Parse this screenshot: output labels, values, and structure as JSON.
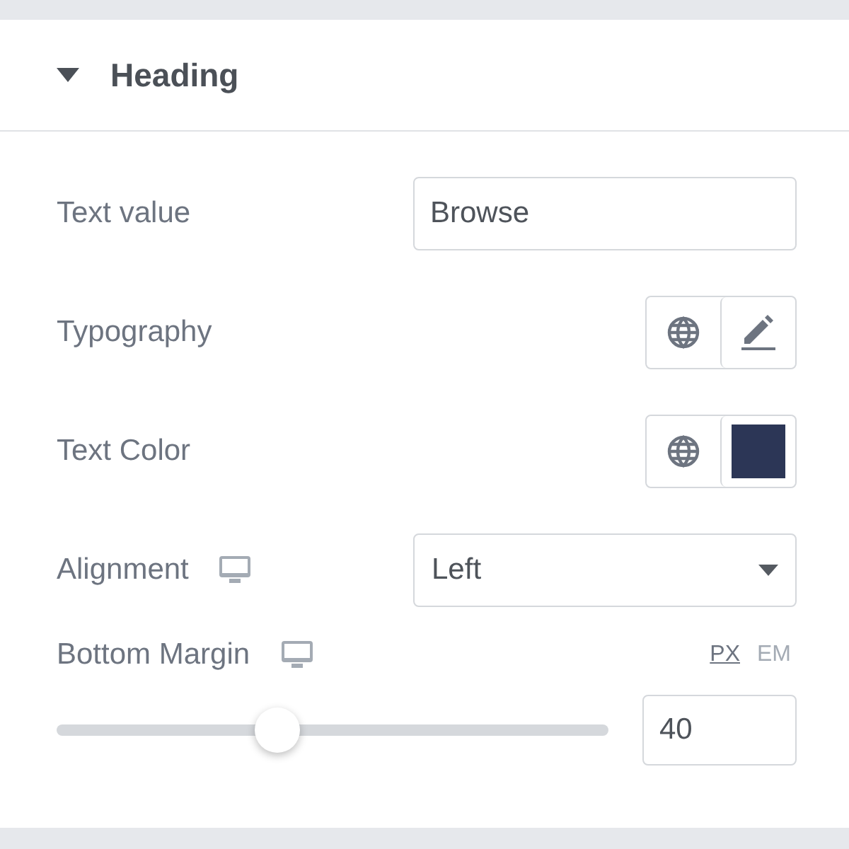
{
  "section": {
    "title": "Heading",
    "expanded": true
  },
  "controls": [
    {
      "kind": "text",
      "label": "Text value",
      "value": "Browse"
    },
    {
      "kind": "typography",
      "label": "Typography"
    },
    {
      "kind": "color",
      "label": "Text Color",
      "color": "#2c3656"
    },
    {
      "kind": "select",
      "label": "Alignment",
      "responsive": true,
      "value": "Left"
    },
    {
      "kind": "slider",
      "label": "Bottom Margin",
      "responsive": true,
      "units": [
        {
          "label": "PX",
          "selected": true
        },
        {
          "label": "EM",
          "selected": false
        }
      ],
      "level": 0.4,
      "value": "40"
    }
  ]
}
